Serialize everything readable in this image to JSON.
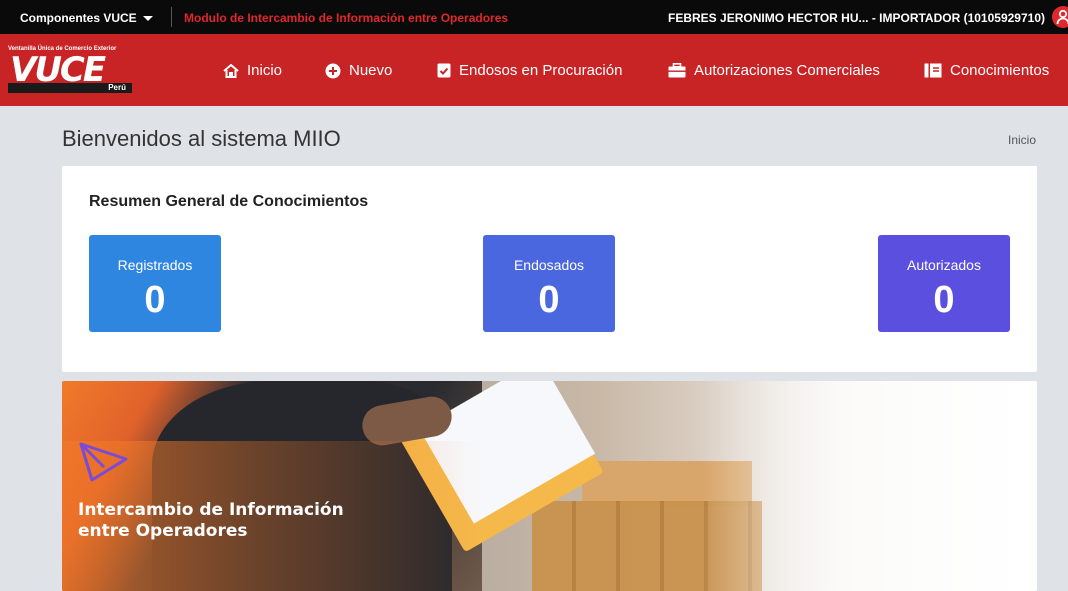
{
  "topbar": {
    "components_label": "Componentes VUCE",
    "module_title": "Modulo de Intercambio de Información entre Operadores",
    "user_label": "FEBRES JERONIMO HECTOR HU... - IMPORTADOR (10105929710)"
  },
  "logo": {
    "tagline": "Ventanilla Única de Comercio Exterior",
    "wordmark": "VUCE",
    "country": "Perú"
  },
  "nav": {
    "items": [
      {
        "label": "Inicio",
        "icon": "home-icon"
      },
      {
        "label": "Nuevo",
        "icon": "plus-circle-icon"
      },
      {
        "label": "Endosos en Procuración",
        "icon": "check-document-icon"
      },
      {
        "label": "Autorizaciones Comerciales",
        "icon": "briefcase-icon"
      },
      {
        "label": "Conocimientos",
        "icon": "book-icon"
      }
    ]
  },
  "page": {
    "title": "Bienvenidos al sistema MIIO",
    "breadcrumb": "Inicio"
  },
  "summary": {
    "title": "Resumen General de Conocimientos",
    "stats": [
      {
        "label": "Registrados",
        "value": "0",
        "color": "#2f86e0"
      },
      {
        "label": "Endosados",
        "value": "0",
        "color": "#4a67e0"
      },
      {
        "label": "Autorizados",
        "value": "0",
        "color": "#5b4fe0"
      }
    ]
  },
  "banner": {
    "line1": "Intercambio de Información",
    "line2": "entre Operadores"
  },
  "colors": {
    "brand_red": "#c82325",
    "topbar_black": "#0a0a0a",
    "module_red": "#e0272b"
  }
}
